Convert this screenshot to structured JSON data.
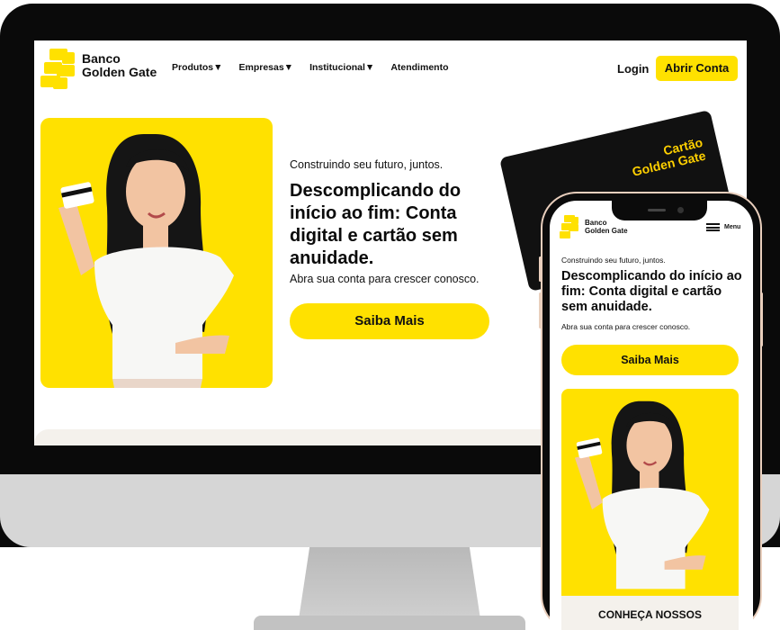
{
  "desktop": {
    "brand": {
      "line1": "Banco",
      "line2": "Golden Gate"
    },
    "nav": [
      {
        "label": "Produtos▼"
      },
      {
        "label": "Empresas▼"
      },
      {
        "label": "Institucional▼"
      },
      {
        "label": "Atendimento"
      }
    ],
    "login_label": "Login",
    "open_account_label": "Abrir Conta",
    "hero": {
      "tagline": "Construindo seu futuro, juntos.",
      "headline": "Descomplicando do início ao fim: Conta digital e cartão sem anuidade.",
      "subtitle": "Abra sua conta para crescer conosco.",
      "cta_label": "Saiba Mais"
    },
    "card": {
      "line1": "Cartão",
      "line2": "Golden Gate"
    }
  },
  "mobile": {
    "brand": {
      "line1": "Banco",
      "line2": "Golden Gate"
    },
    "menu_label": "Menu",
    "hero": {
      "tagline": "Construindo seu futuro, juntos.",
      "headline": "Descomplicando do início ao fim: Conta digital e cartão sem anuidade.",
      "subtitle": "Abra sua conta para crescer conosco.",
      "cta_label": "Saiba Mais"
    },
    "section_title": "CONHEÇA NOSSOS"
  },
  "colors": {
    "accent": "#ffe100",
    "dark": "#0a0a0a",
    "card_text": "#ffd000",
    "strip": "#f4f1ec"
  },
  "icons": [
    "logo-icon",
    "hamburger-menu-icon",
    "dropdown-caret-icon"
  ]
}
